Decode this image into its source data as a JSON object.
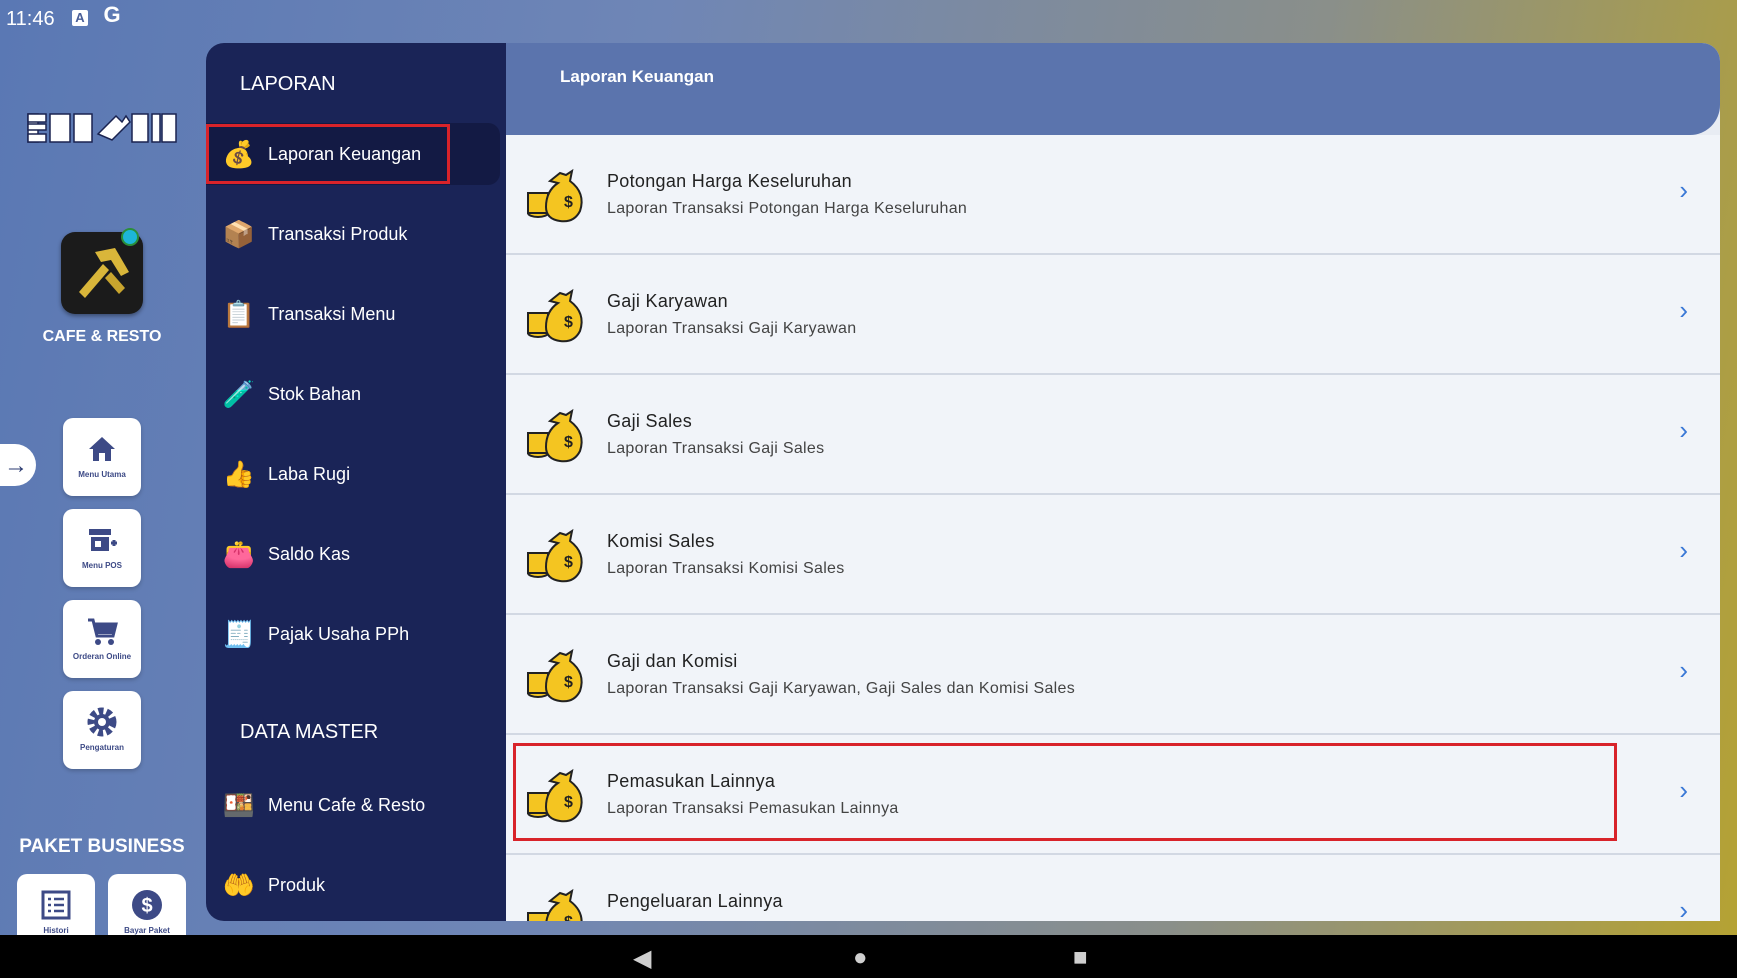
{
  "status_bar": {
    "time": "11:46",
    "icon_a": "A",
    "icon_g": "G"
  },
  "rail": {
    "logo_text": "BOC⚒AJA",
    "app_label": "CAFE & RESTO",
    "buttons": [
      {
        "label": "Menu Utama",
        "icon": "home-icon"
      },
      {
        "label": "Menu POS",
        "icon": "store-add-icon"
      },
      {
        "label": "Orderan Online",
        "icon": "cart-icon"
      },
      {
        "label": "Pengaturan",
        "icon": "gear-icon"
      }
    ],
    "paket_label": "PAKET BUSINESS",
    "bottom_buttons": [
      {
        "label": "Histori",
        "icon": "list-icon"
      },
      {
        "label": "Bayar Paket",
        "icon": "dollar-icon"
      }
    ]
  },
  "sidebar": {
    "section1": "LAPORAN",
    "laporan_items": [
      {
        "label": "Laporan Keuangan",
        "glyph": "💰"
      },
      {
        "label": "Transaksi Produk",
        "glyph": "📦"
      },
      {
        "label": "Transaksi Menu",
        "glyph": "📋"
      },
      {
        "label": "Stok Bahan",
        "glyph": "🧪"
      },
      {
        "label": "Laba Rugi",
        "glyph": "👍"
      },
      {
        "label": "Saldo Kas",
        "glyph": "👛"
      },
      {
        "label": "Pajak Usaha PPh",
        "glyph": "🧾"
      }
    ],
    "section2": "DATA MASTER",
    "master_items": [
      {
        "label": "Menu Cafe & Resto",
        "glyph": "🍱"
      },
      {
        "label": "Produk",
        "glyph": "🤲"
      }
    ]
  },
  "main": {
    "header_title": "Laporan Keuangan",
    "rows": [
      {
        "title": "Potongan Harga Keseluruhan",
        "subtitle": "Laporan Transaksi Potongan Harga Keseluruhan"
      },
      {
        "title": "Gaji Karyawan",
        "subtitle": "Laporan Transaksi Gaji Karyawan"
      },
      {
        "title": "Gaji Sales",
        "subtitle": "Laporan Transaksi Gaji Sales"
      },
      {
        "title": "Komisi Sales",
        "subtitle": "Laporan Transaksi Komisi Sales"
      },
      {
        "title": "Gaji dan Komisi",
        "subtitle": "Laporan Transaksi Gaji Karyawan, Gaji Sales dan Komisi Sales"
      },
      {
        "title": "Pemasukan Lainnya",
        "subtitle": "Laporan Transaksi Pemasukan Lainnya"
      },
      {
        "title": "Pengeluaran Lainnya",
        "subtitle": ""
      }
    ]
  },
  "colors": {
    "accent": "#3a78d6",
    "sidebar": "#1a2457",
    "highlight": "#d8232a"
  }
}
